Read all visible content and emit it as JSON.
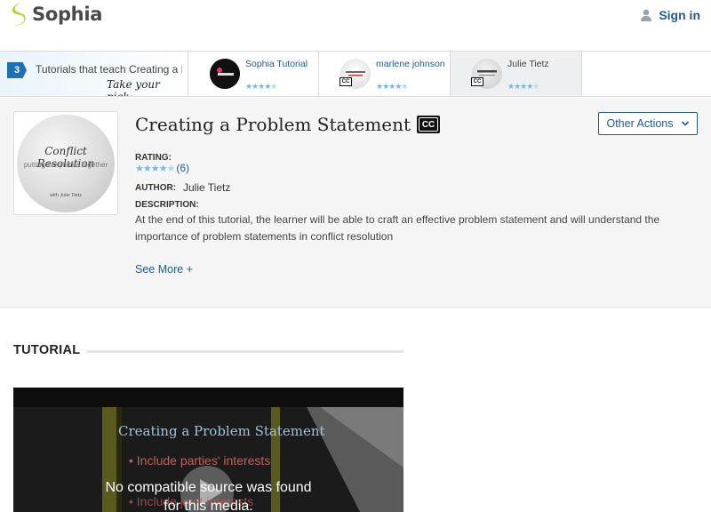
{
  "header": {
    "logo_text": "Sophia",
    "signin_label": "Sign in"
  },
  "strip": {
    "count": "3",
    "title": "Tutorials that teach Creating a Problem Statement",
    "pick_text": "Take your pick:",
    "cards": [
      {
        "name": "Sophia Tutorial",
        "rating": 4.5,
        "cc": false,
        "active": false
      },
      {
        "name": "marlene johnson",
        "rating": 4.5,
        "cc": true,
        "active": false
      },
      {
        "name": "Julie Tietz",
        "rating": 4,
        "cc": true,
        "active": true
      }
    ]
  },
  "tutorial": {
    "title": "Creating a Problem Statement",
    "cc_label": "CC",
    "other_actions_label": "Other Actions",
    "rating_label": "RATING:",
    "rating_count": "(6)",
    "rating_value": 4.5,
    "author_label": "AUTHOR:",
    "author": "Julie Tietz",
    "description_label": "DESCRIPTION:",
    "description": "At the end of this tutorial, the learner will be able to craft an effective problem statement and will understand the importance of problem statements in conflict resolution",
    "see_more_label": "See More +",
    "cover": {
      "title": "Conflict Resolution",
      "subtitle": "putting the pieces together",
      "byline": "with Julie Tietz"
    }
  },
  "section": {
    "heading": "TUTORIAL"
  },
  "video": {
    "slide_title": "Creating a Problem Statement",
    "bullet_1": "• Include parties' interests",
    "bullet_2": "• Include joint interests",
    "error_line_1": "No compatible source was found",
    "error_line_2": "for this media."
  },
  "colors": {
    "link": "#1f5a8f",
    "logo_green": "#b5d334",
    "star": "#7bb6df"
  }
}
